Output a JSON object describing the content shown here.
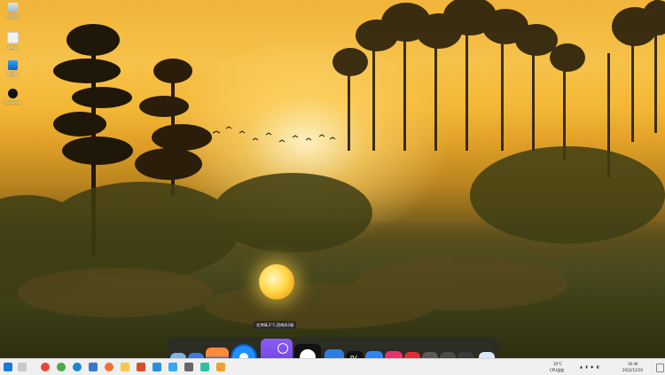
{
  "desktop": {
    "icons": [
      {
        "label": "回收站",
        "icon": "recycle-bin-icon"
      },
      {
        "label": "temp",
        "icon": "folder-icon"
      },
      {
        "label": "此电脑",
        "icon": "computer-icon"
      },
      {
        "label": "OneDrive",
        "icon": "onedrive-icon"
      }
    ]
  },
  "dock": {
    "tooltip": "北京晴,2°C,西南风2级",
    "weather_temp": "2°",
    "items": [
      "finder-icon",
      "launchpad-icon",
      "files-icon",
      "settings-gear-icon",
      "weather-icon",
      "circle-app-icon",
      "app-store-icon",
      "percent-app-icon",
      "search-icon",
      "crop-tool-icon",
      "record-icon",
      "control-center-icon",
      "more-icon",
      "power-icon",
      "recycle-icon"
    ]
  },
  "taskbar": {
    "apps": [
      "windows-start-icon",
      "search-icon",
      "chrome-icon",
      "chrome-alt-icon",
      "edge-icon",
      "explorer-icon",
      "firefox-icon",
      "folder-icon",
      "office-icon",
      "p-app-icon",
      "check-app-icon",
      "image-viewer-icon",
      "app-icon",
      "app2-icon"
    ],
    "weather": "10°C",
    "weather_desc": "CPU温度",
    "clock_time": "16:46",
    "clock_date": "2022/12/10"
  },
  "colors": {
    "sky_top": "#f2b43a",
    "dock_bg": "rgba(40,40,50,0.55)",
    "taskbar_bg": "#f0f0f0"
  }
}
